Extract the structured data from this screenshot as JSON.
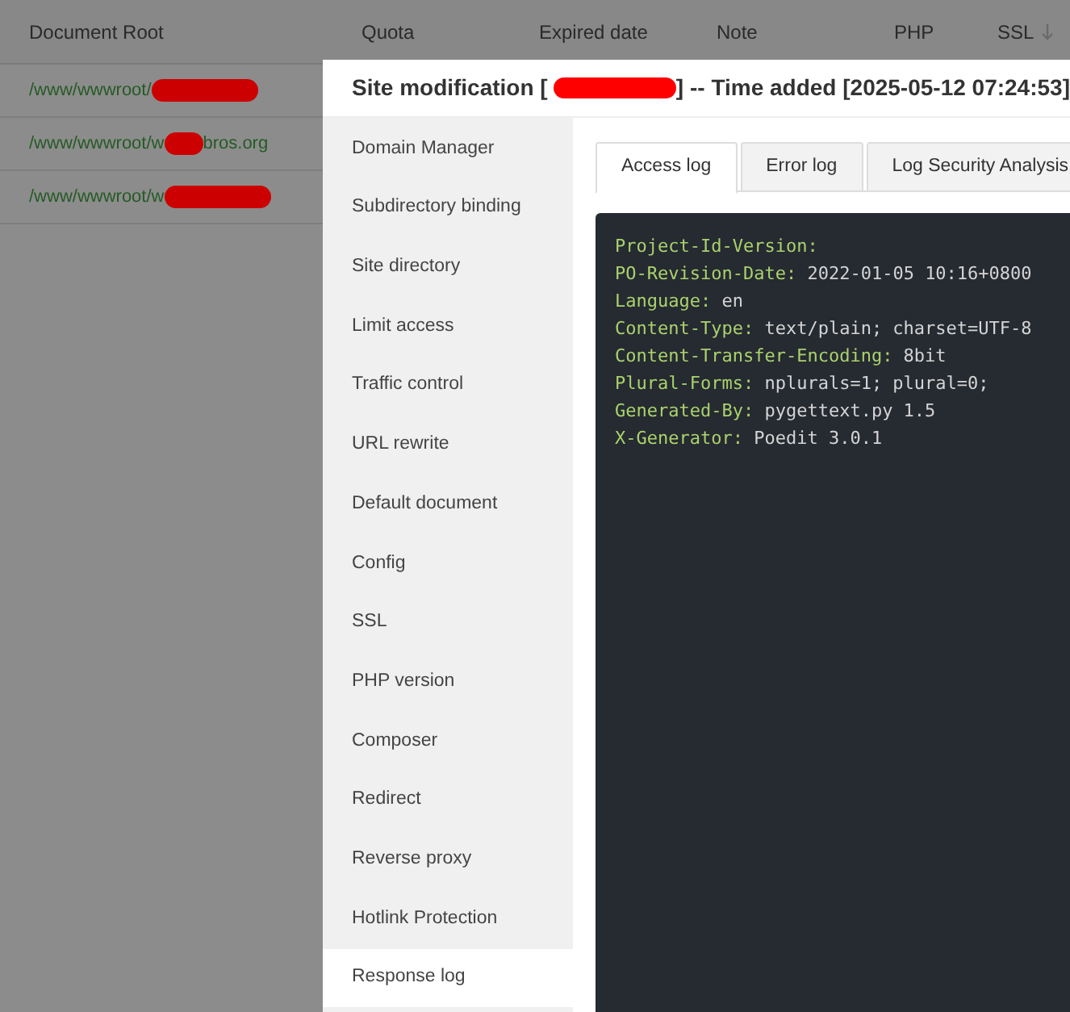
{
  "table": {
    "columns": [
      {
        "label": "Document Root",
        "sortable": false
      },
      {
        "label": "Quota",
        "sortable": false
      },
      {
        "label": "Expired date",
        "sortable": false
      },
      {
        "label": "Note",
        "sortable": false
      },
      {
        "label": "PHP",
        "sortable": false
      },
      {
        "label": "SSL",
        "sortable": true
      }
    ],
    "rows": [
      {
        "path": "/www/wwwroot/"
      },
      {
        "path": "/www/wwwroot/w",
        "tail": "bros.org"
      },
      {
        "path": "/www/wwwroot/w"
      }
    ]
  },
  "dialog": {
    "title_prefix": "Site modification [",
    "title_suffix": "] -- Time added [2025-05-12 07:24:53]",
    "menu": [
      {
        "label": "Domain Manager",
        "selected": false
      },
      {
        "label": "Subdirectory binding",
        "selected": false
      },
      {
        "label": "Site directory",
        "selected": false
      },
      {
        "label": "Limit access",
        "selected": false
      },
      {
        "label": "Traffic control",
        "selected": false
      },
      {
        "label": "URL rewrite",
        "selected": false
      },
      {
        "label": "Default document",
        "selected": false
      },
      {
        "label": "Config",
        "selected": false
      },
      {
        "label": "SSL",
        "selected": false
      },
      {
        "label": "PHP version",
        "selected": false
      },
      {
        "label": "Composer",
        "selected": false
      },
      {
        "label": "Redirect",
        "selected": false
      },
      {
        "label": "Reverse proxy",
        "selected": false
      },
      {
        "label": "Hotlink Protection",
        "selected": false
      },
      {
        "label": "Response log",
        "selected": true
      }
    ],
    "tabs": [
      {
        "label": "Access log",
        "selected": true
      },
      {
        "label": "Error log",
        "selected": false
      },
      {
        "label": "Log Security Analysis",
        "selected": false
      }
    ],
    "log_lines": [
      {
        "key": "Project-Id-Version:"
      },
      {
        "key": "PO-Revision-Date:",
        "value": "2022-01-05 10:16+0800"
      },
      {
        "key": "Language:",
        "value": "en"
      },
      {
        "key": "Content-Type:",
        "value": "text/plain; charset=UTF-8"
      },
      {
        "key": "Content-Transfer-Encoding:",
        "value": "8bit"
      },
      {
        "key": "Plural-Forms:",
        "value": "nplurals=1; plural=0;"
      },
      {
        "key": "Generated-By:",
        "value": "pygettext.py 1.5"
      },
      {
        "key": "X-Generator:",
        "value": "Poedit 3.0.1"
      }
    ]
  }
}
